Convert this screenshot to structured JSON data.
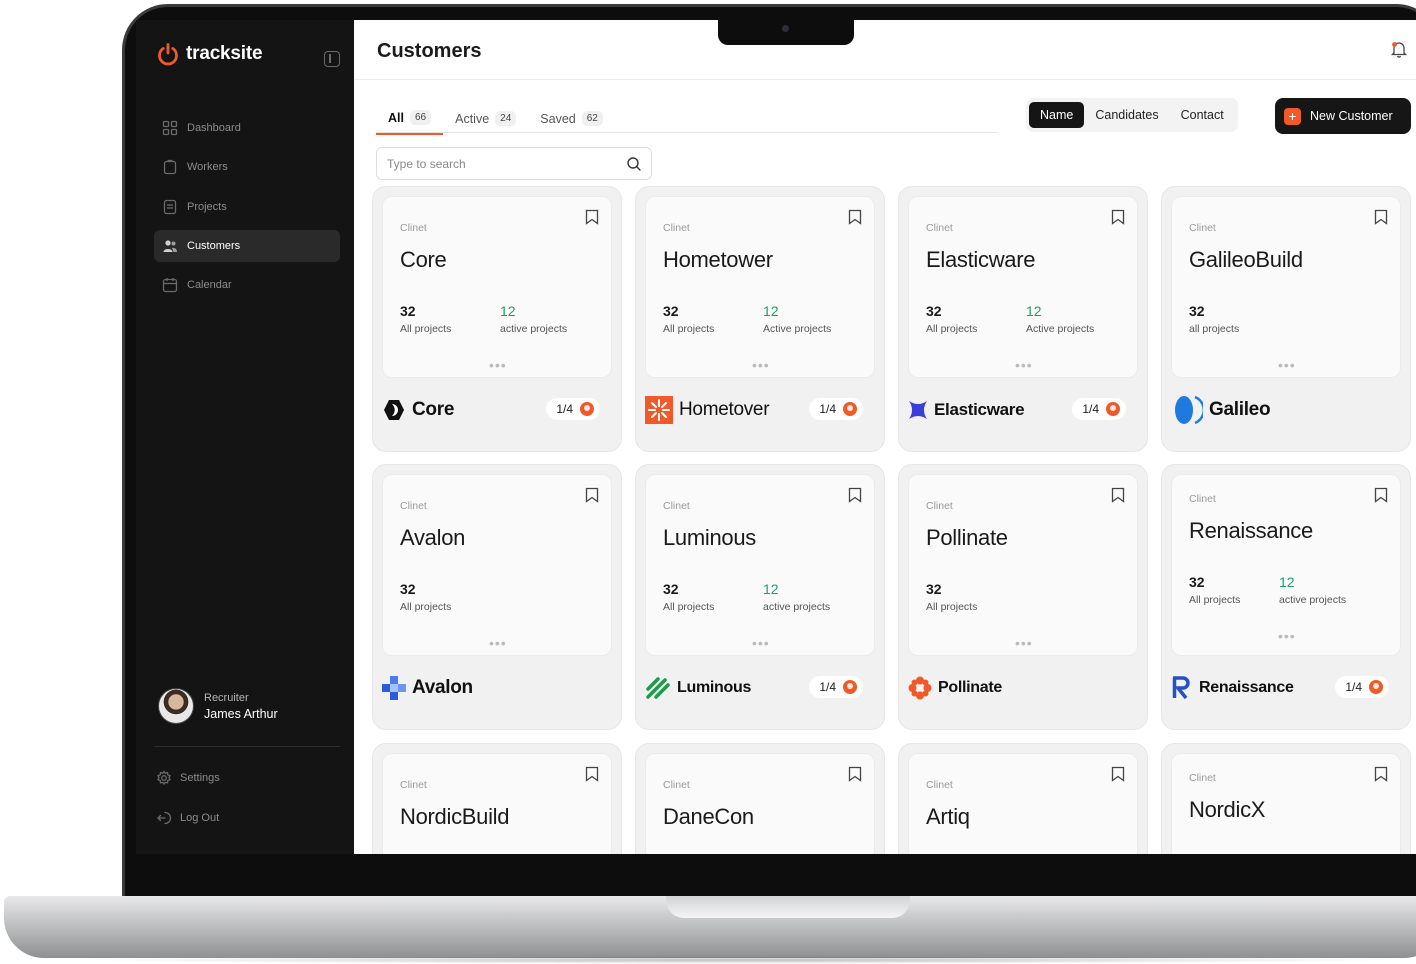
{
  "brand": {
    "name": "tracksite",
    "accent": "#f05a28"
  },
  "sidebar": {
    "items": [
      {
        "label": "Dashboard",
        "icon": "grid-icon"
      },
      {
        "label": "Workers",
        "icon": "clipboard-icon"
      },
      {
        "label": "Projects",
        "icon": "document-icon"
      },
      {
        "label": "Customers",
        "icon": "users-icon",
        "active": true
      },
      {
        "label": "Calendar",
        "icon": "calendar-icon"
      }
    ],
    "user": {
      "role": "Recruiter",
      "name": "James Arthur"
    },
    "bottom": [
      {
        "label": "Settings",
        "icon": "gear-icon"
      },
      {
        "label": "Log Out",
        "icon": "logout-icon"
      }
    ]
  },
  "header": {
    "title": "Customers"
  },
  "tabs": [
    {
      "label": "All",
      "count": "66",
      "active": true
    },
    {
      "label": "Active",
      "count": "24"
    },
    {
      "label": "Saved",
      "count": "62"
    }
  ],
  "segment": {
    "options": [
      "Name",
      "Candidates",
      "Contact"
    ],
    "selected": "Name"
  },
  "new_customer_label": "New Customer",
  "search": {
    "placeholder": "Type to search"
  },
  "cards": [
    {
      "label": "Clinet",
      "title": "Core",
      "all_num": "32",
      "all_lbl": "All projects",
      "active_num": "12",
      "active_lbl": "active projects",
      "brand": "Core",
      "pager": "1/4"
    },
    {
      "label": "Clinet",
      "title": "Hometower",
      "all_num": "32",
      "all_lbl": "All projects",
      "active_num": "12",
      "active_lbl": "Active projects",
      "brand": "Hometover",
      "pager": "1/4"
    },
    {
      "label": "Clinet",
      "title": "Elasticware",
      "all_num": "32",
      "all_lbl": "All projects",
      "active_num": "12",
      "active_lbl": "Active projects",
      "brand": "Elasticware",
      "pager": "1/4"
    },
    {
      "label": "Clinet",
      "title": "GalileoBuild",
      "all_num": "32",
      "all_lbl": "all projects",
      "active_num": "",
      "active_lbl": "",
      "brand": "Galileo",
      "pager": ""
    },
    {
      "label": "Clinet",
      "title": "Avalon",
      "all_num": "32",
      "all_lbl": "All projects",
      "active_num": "",
      "active_lbl": "",
      "brand": "Avalon",
      "pager": ""
    },
    {
      "label": "Clinet",
      "title": "Luminous",
      "all_num": "32",
      "all_lbl": "All projects",
      "active_num": "12",
      "active_lbl": "active projects",
      "brand": "Luminous",
      "pager": "1/4"
    },
    {
      "label": "Clinet",
      "title": "Pollinate",
      "all_num": "32",
      "all_lbl": "All projects",
      "active_num": "",
      "active_lbl": "",
      "brand": "Pollinate",
      "pager": ""
    },
    {
      "label": "Clinet",
      "title": "Renaissance",
      "all_num": "32",
      "all_lbl": "All projects",
      "active_num": "12",
      "active_lbl": "active projects",
      "brand": "Renaissance",
      "pager": "1/4"
    },
    {
      "label": "Clinet",
      "title": "NordicBuild"
    },
    {
      "label": "Clinet",
      "title": "DaneCon"
    },
    {
      "label": "Clinet",
      "title": "Artiq"
    },
    {
      "label": "Clinet",
      "title": "NordicX"
    }
  ]
}
